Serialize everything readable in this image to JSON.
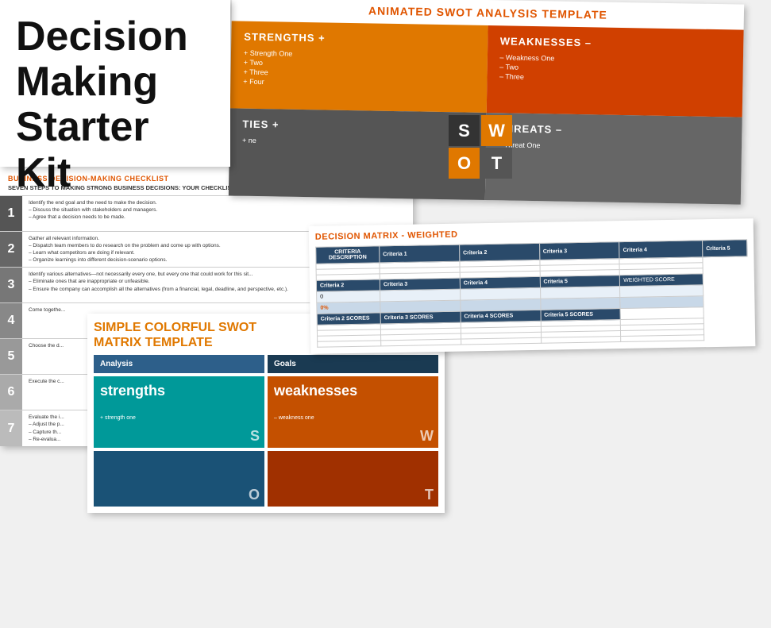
{
  "title": "Decision Making Starter Kit",
  "animated_swot": {
    "title": "ANIMATED SWOT ANALYSIS TEMPLATE",
    "strengths_label": "STRENGTHS  +",
    "weaknesses_label": "WEAKNESSES  –",
    "strengths_items": [
      "Strength One",
      "Two",
      "Three",
      "Four"
    ],
    "weaknesses_items": [
      "Weakness One",
      "Two",
      "Three"
    ],
    "opportunities_label": "TIES  +",
    "opportunities_items": [
      "ne"
    ],
    "threats_label": "THREATS  –",
    "threats_items": [
      "Threat One"
    ],
    "logo_s": "S",
    "logo_w": "W",
    "logo_o": "O",
    "logo_t": "T"
  },
  "checklist": {
    "title": "BUSINESS DECISION-MAKING CHECKLIST",
    "subtitle": "SEVEN STEPS TO MAKING STRONG BUSINESS DECISIONS: YOUR CHECKLIST",
    "items": [
      {
        "num": "1",
        "text": "Identify the end goal and the need to make the decision.\n– Discuss the situation with stakeholders and managers.\n– Agree that a decision needs to be made."
      },
      {
        "num": "2",
        "text": "Gather all relevant information.\n– Dispatch team members to do research on the problem and come up with options.\n– Learn what competitors are doing if relevant.\n– Organize learnings into different decision-scenario options."
      },
      {
        "num": "3",
        "text": "Identify various alternatives—not necessarily every one, but every one that could work for this sit...\n– Eliminate ones that are inappropriate or unfeasible.\n– Ensure the company can accomplish all the alternatives (from a financial, legal, deadline, and perspective, etc.)."
      },
      {
        "num": "4",
        "text": "Come togethe..."
      },
      {
        "num": "5",
        "text": "Choose the d..."
      },
      {
        "num": "6",
        "text": "Execute the c..."
      },
      {
        "num": "7",
        "text": "Evaluate the i...\n– Adjust the p...\n– Capture th...\n– Re-evalua..."
      }
    ]
  },
  "simple_swot": {
    "title": "SIMPLE COLORFUL SWOT",
    "title2": "MATRIX TEMPLATE",
    "header1": "Analysis",
    "header2": "Goals",
    "strengths_label": "strengths",
    "weaknesses_label": "weaknesses",
    "strength_item": "+ strength one",
    "weakness_item": "– weakness one",
    "s_letter": "S",
    "w_letter": "W",
    "o_letter": "O",
    "t_letter": "T"
  },
  "decision_matrix": {
    "title": "DECISION MATRIX - WEIGHTED",
    "criteria_headers": [
      "Criteria 1",
      "Criteria 2",
      "Criteria 3",
      "Criteria 4",
      "Criteria 5"
    ],
    "criteria_desc": "CRITERIA DESCRIPTION",
    "row_labels": [
      "Criteria 2",
      "Criteria 3",
      "Criteria 4",
      "Criteria 5",
      "WEIGHTED SCORE"
    ],
    "score_labels": [
      "Criteria 2 SCORES",
      "Criteria 3 SCORES",
      "Criteria 4 SCORES",
      "Criteria 5 SCORES"
    ],
    "score_value": "0",
    "percent_value": "0%"
  }
}
